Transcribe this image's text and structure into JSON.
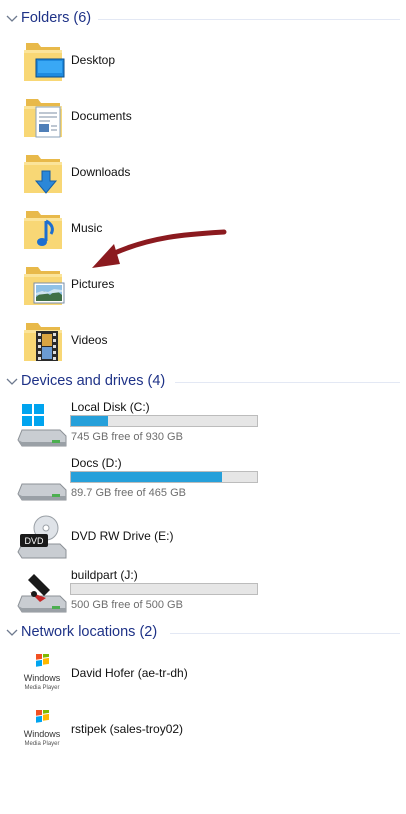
{
  "groups": {
    "folders": {
      "title": "Folders (6)",
      "items": [
        {
          "label": "Desktop",
          "icon": "desktop-folder-icon"
        },
        {
          "label": "Documents",
          "icon": "documents-folder-icon"
        },
        {
          "label": "Downloads",
          "icon": "downloads-folder-icon"
        },
        {
          "label": "Music",
          "icon": "music-folder-icon"
        },
        {
          "label": "Pictures",
          "icon": "pictures-folder-icon"
        },
        {
          "label": "Videos",
          "icon": "videos-folder-icon"
        }
      ]
    },
    "devices": {
      "title": "Devices and drives (4)",
      "items": [
        {
          "label": "Local Disk (C:)",
          "free": "745 GB free of 930 GB",
          "used_fraction": 0.2,
          "icon": "windows-drive-icon"
        },
        {
          "label": "Docs (D:)",
          "free": "89.7 GB free of 465 GB",
          "used_fraction": 0.81,
          "icon": "hard-drive-icon"
        },
        {
          "label": "DVD RW Drive (E:)",
          "icon": "dvd-drive-icon"
        },
        {
          "label": "buildpart (J:)",
          "free": "500 GB free of 500 GB",
          "used_fraction": 0.0,
          "icon": "network-drive-icon"
        }
      ]
    },
    "network": {
      "title": "Network locations (2)",
      "items": [
        {
          "label": "David Hofer (ae-tr-dh)",
          "icon": "windows-media-player-icon",
          "logo_line1": "Windows",
          "logo_line2": "Media Player"
        },
        {
          "label": "rstipek (sales-troy02)",
          "icon": "windows-media-player-icon",
          "logo_line1": "Windows",
          "logo_line2": "Media Player"
        }
      ]
    }
  },
  "colors": {
    "header_text": "#1e3287",
    "header_rule": "#e3e8f4",
    "bar_fill": "#26a0da",
    "bar_bg": "#e6e6e6",
    "arrow": "#8b1a1f",
    "folder": "#f8d775"
  },
  "dvd_badge": "DVD"
}
